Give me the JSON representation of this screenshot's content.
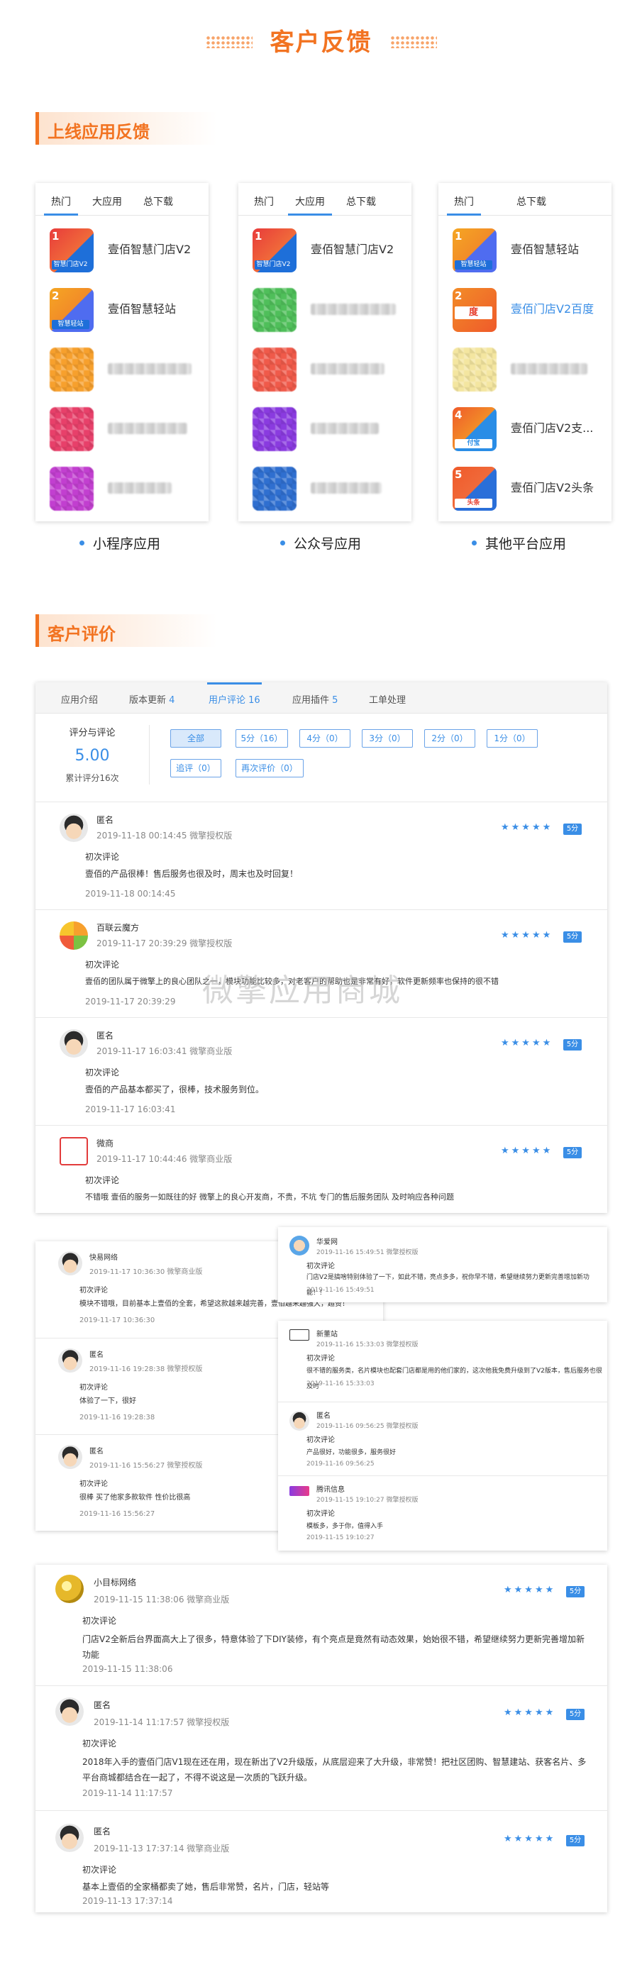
{
  "header": {
    "title": "客户反馈"
  },
  "sections": {
    "apps": "上线应用反馈",
    "reviews": "客户评价"
  },
  "app_columns": [
    {
      "label": "小程序应用",
      "tabs": [
        "热门",
        "大应用",
        "总下载"
      ],
      "active_tab": 0,
      "apps": [
        {
          "rank": "1",
          "name": "壹佰智慧门店V2",
          "strip": "智慧门店V2"
        },
        {
          "rank": "2",
          "name": "壹佰智慧轻站",
          "strip": "智慧轻站"
        },
        {
          "rank": "",
          "name": "",
          "strip": ""
        },
        {
          "rank": "",
          "name": "",
          "strip": ""
        },
        {
          "rank": "",
          "name": "",
          "strip": ""
        }
      ]
    },
    {
      "label": "公众号应用",
      "tabs": [
        "热门",
        "大应用",
        "总下载"
      ],
      "active_tab": 1,
      "apps": [
        {
          "rank": "1",
          "name": "壹佰智慧门店V2",
          "strip": "智慧门店V2"
        },
        {
          "rank": "",
          "name": "",
          "strip": ""
        },
        {
          "rank": "",
          "name": "",
          "strip": ""
        },
        {
          "rank": "",
          "name": "",
          "strip": ""
        },
        {
          "rank": "",
          "name": "",
          "strip": ""
        }
      ]
    },
    {
      "label": "其他平台应用",
      "tabs": [
        "热门",
        "总下载"
      ],
      "active_tab": 0,
      "apps": [
        {
          "rank": "1",
          "name": "壹佰智慧轻站",
          "strip": "智慧轻站"
        },
        {
          "rank": "2",
          "name": "壹佰门店V2百度",
          "strip": "度"
        },
        {
          "rank": "",
          "name": "",
          "strip": ""
        },
        {
          "rank": "4",
          "name": "壹佰门店V2支...",
          "strip": "付宝"
        },
        {
          "rank": "5",
          "name": "壹佰门店V2头条",
          "strip": "头条"
        }
      ]
    }
  ],
  "review_panel": {
    "tabs": [
      {
        "label": "应用介绍",
        "count": ""
      },
      {
        "label": "版本更新",
        "count": "4"
      },
      {
        "label": "用户评论",
        "count": "16"
      },
      {
        "label": "应用插件",
        "count": "5"
      },
      {
        "label": "工单处理",
        "count": ""
      }
    ],
    "score_title": "评分与评论",
    "score": "5.00",
    "score_total": "累计评分16次",
    "filters": [
      "全部",
      "5分（16）",
      "4分（0）",
      "3分（0）",
      "2分（0）",
      "1分（0）",
      "追评（0）",
      "再次评价（0）"
    ],
    "reviews": [
      {
        "name": "匿名",
        "date": "2019-11-18 00:14:45 微擎授权版",
        "type": "初次评论",
        "text": "壹佰的产品很棒！售后服务也很及时，周末也及时回复！",
        "sub_date": "2019-11-18 00:14:45",
        "stars": "★★★★★",
        "score": "5分"
      },
      {
        "name": "百联云魔方",
        "date": "2019-11-17 20:39:29 微擎授权版",
        "type": "初次评论",
        "text": "壹佰的团队属于微擎上的良心团队之一，模块功能比较多，对老客户的帮助也是非常有好，软件更新频率也保持的很不错",
        "sub_date": "2019-11-17 20:39:29",
        "stars": "★★★★★",
        "score": "5分"
      },
      {
        "name": "匿名",
        "date": "2019-11-17 16:03:41 微擎商业版",
        "type": "初次评论",
        "text": "壹佰的产品基本都买了，很棒，技术服务到位。",
        "sub_date": "2019-11-17 16:03:41",
        "stars": "★★★★★",
        "score": "5分"
      },
      {
        "name": "微商",
        "date": "2019-11-17 10:44:46 微擎商业版",
        "type": "初次评论",
        "text": "不错哦 壹佰的服务一如既往的好 微擎上的良心开发商，不贵，不坑 专门的售后服务团队 及时响应各种问题",
        "sub_date": "",
        "stars": "★★★★★",
        "score": "5分"
      }
    ]
  },
  "collage_left": [
    {
      "name": "快易网络",
      "date": "2019-11-17 10:36:30 微擎商业版",
      "type": "初次评论",
      "text": "模块不错哦，目前基本上壹佰的全套，希望这款越来越完善，壹佰越来越强大，超赞！",
      "sub_date": "2019-11-17 10:36:30"
    },
    {
      "name": "匿名",
      "date": "2019-11-16 19:28:38 微擎授权版",
      "type": "初次评论",
      "text": "体验了一下，很好",
      "sub_date": "2019-11-16 19:28:38"
    },
    {
      "name": "匿名",
      "date": "2019-11-16 15:56:27 微擎授权版",
      "type": "初次评论",
      "text": "很棒 买了他家多款软件 性价比很高",
      "sub_date": "2019-11-16 15:56:27"
    }
  ],
  "collage_right_top": {
    "name": "华爱网",
    "date": "2019-11-16 15:49:51 微擎授权版",
    "type": "初次评论",
    "text": "门店V2是搞啥特别体验了一下，如此不错，亮点多多，祝你早不错，希望继续努力更新完善增加新功能！！",
    "sub_date": "2019-11-16 15:49:51"
  },
  "collage_right": [
    {
      "name": "新董站",
      "date": "2019-11-16 15:33:03 微擎授权版",
      "type": "初次评论",
      "text": "很不错的服务类，名片模块也配套门店都是用的他们家的，这次他我免费升级到了V2版本，售后服务也很及时",
      "sub_date": "2019-11-16 15:33:03"
    },
    {
      "name": "匿名",
      "date": "2019-11-16 09:56:25 微擎授权版",
      "type": "初次评论",
      "text": "产品很好，功能很多，服务很好",
      "sub_date": "2019-11-16 09:56:25"
    },
    {
      "name": "腾讯信息",
      "date": "2019-11-15 19:10:27 微擎授权版",
      "type": "初次评论",
      "text": "模板多，多于你，值得入手",
      "sub_date": "2019-11-15 19:10:27"
    }
  ],
  "bottom_reviews": [
    {
      "name": "小目标网络",
      "date": "2019-11-15 11:38:06 微擎商业版",
      "type": "初次评论",
      "text": "门店V2全新后台界面高大上了很多，特意体验了下DIY装修，有个亮点是竟然有动态效果，始始很不错，希望继续努力更新完善增加新功能",
      "sub_date": "2019-11-15 11:38:06",
      "stars": "★★★★★",
      "score": "5分"
    },
    {
      "name": "匿名",
      "date": "2019-11-14 11:17:57 微擎授权版",
      "type": "初次评论",
      "text": "2018年入手的壹佰门店V1现在还在用，现在新出了V2升级版，从底层迎来了大升级，非常赞！把社区团购、智慧建站、获客名片、多平台商城都结合在一起了，不得不说这是一次质的飞跃升级。",
      "sub_date": "2019-11-14 11:17:57",
      "stars": "★★★★★",
      "score": "5分"
    },
    {
      "name": "匿名",
      "date": "2019-11-13 17:37:14 微擎商业版",
      "type": "初次评论",
      "text": "基本上壹佰的全家桶都卖了她，售后非常赞，名片，门店，轻站等",
      "sub_date": "2019-11-13 17:37:14",
      "stars": "★★★★★",
      "score": "5分"
    }
  ],
  "watermark": "微擎应用商城",
  "colors": {
    "accent": "#f27321",
    "blue": "#3a8ee6"
  }
}
